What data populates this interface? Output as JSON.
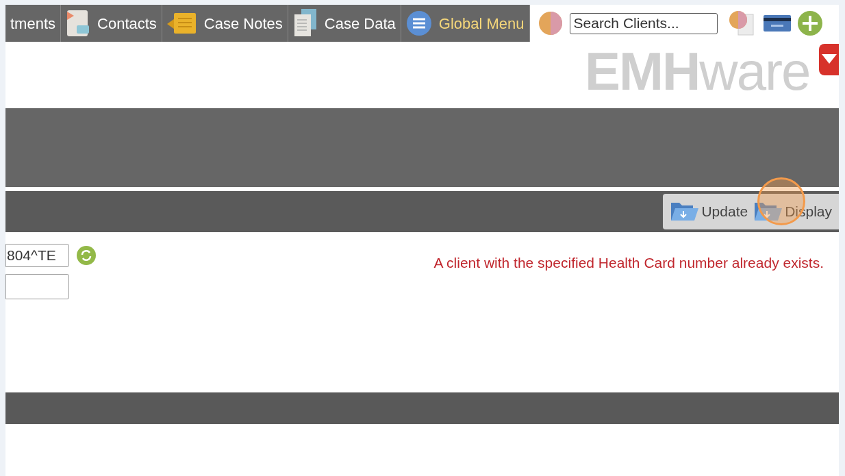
{
  "nav_tabs": [
    {
      "label": "tments",
      "kind": "plain",
      "selected": false
    },
    {
      "label": "Contacts",
      "kind": "contacts",
      "selected": false
    },
    {
      "label": "Case Notes",
      "kind": "notes",
      "selected": false
    },
    {
      "label": "Case Data",
      "kind": "data",
      "selected": false
    },
    {
      "label": "Global Menu",
      "kind": "menu",
      "selected": true
    }
  ],
  "search": {
    "placeholder": "Search Clients..."
  },
  "logo": "**EMH**ware",
  "toolbar_buttons": [
    {
      "label": "Update"
    },
    {
      "label": "Display"
    }
  ],
  "health_card_field": {
    "value": "804^TE"
  },
  "error_message": "A client with the specified Health Card number already exists."
}
